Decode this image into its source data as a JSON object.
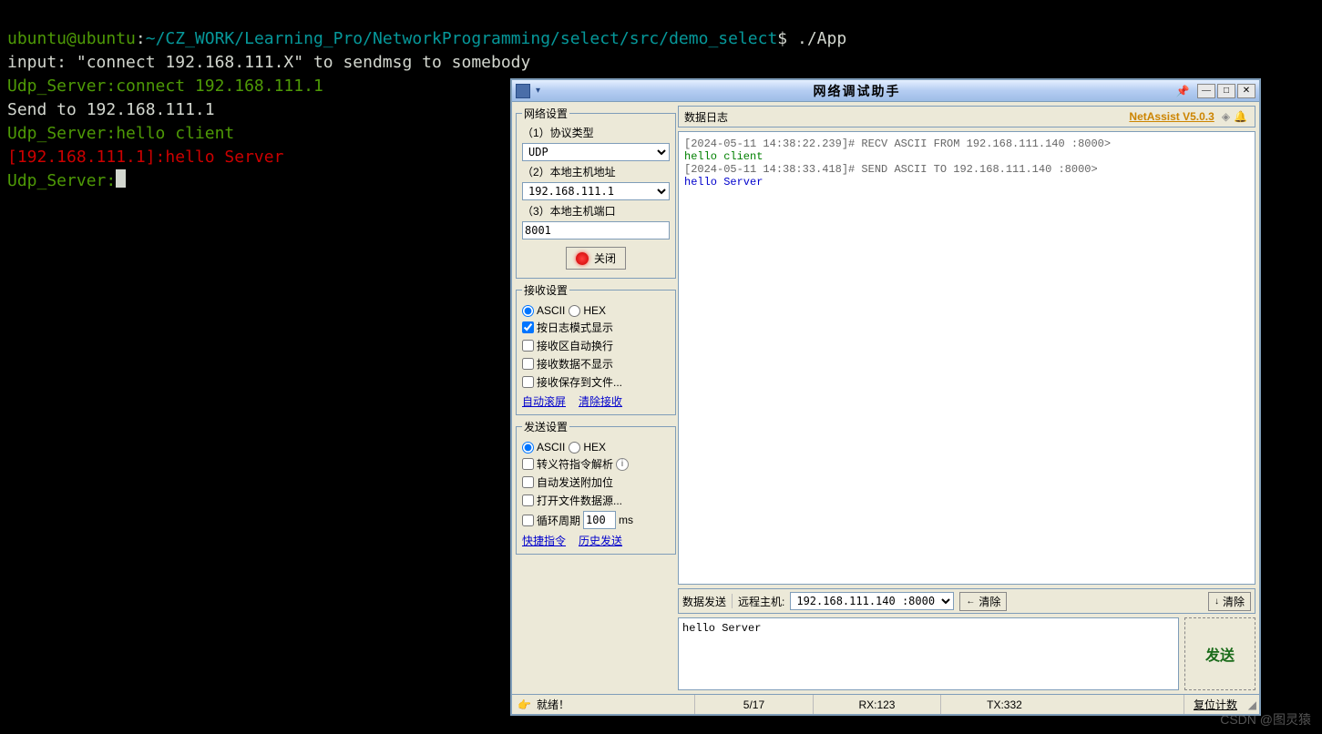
{
  "terminal": {
    "prompt_user": "ubuntu@ubuntu",
    "prompt_path": "~/CZ_WORK/Learning_Pro/NetworkProgramming/select/src/demo_select",
    "prompt_cmd": "./App",
    "line2": "input: \"connect 192.168.111.X\" to sendmsg to somebody",
    "line3": "Udp_Server:connect 192.168.111.1",
    "line4": "Send to 192.168.111.1",
    "line5": "Udp_Server:hello client",
    "line6_prefix": "[192.168.111.1]:",
    "line6_msg": "hello Server",
    "line7": "Udp_Server:"
  },
  "app": {
    "title": "网络调试助手",
    "brand": "NetAssist V5.0.3",
    "groups": {
      "net": "网络设置",
      "recv": "接收设置",
      "send": "发送设置"
    },
    "net": {
      "proto_label": "（1）协议类型",
      "proto_value": "UDP",
      "host_label": "（2）本地主机地址",
      "host_value": "192.168.111.1",
      "port_label": "（3）本地主机端口",
      "port_value": "8001",
      "close_btn": "关闭"
    },
    "recv": {
      "ascii": "ASCII",
      "hex": "HEX",
      "opt1": "按日志模式显示",
      "opt2": "接收区自动换行",
      "opt3": "接收数据不显示",
      "opt4": "接收保存到文件...",
      "link1": "自动滚屏",
      "link2": "清除接收"
    },
    "send": {
      "ascii": "ASCII",
      "hex": "HEX",
      "opt1": "转义符指令解析",
      "opt2": "自动发送附加位",
      "opt3": "打开文件数据源...",
      "opt4_pre": "循环周期",
      "opt4_val": "100",
      "opt4_suf": "ms",
      "link1": "快捷指令",
      "link2": "历史发送"
    },
    "log": {
      "header": "数据日志",
      "l1": "[2024-05-11 14:38:22.239]# RECV ASCII FROM 192.168.111.140 :8000>",
      "l2": "hello client",
      "l3": "[2024-05-11 14:38:33.418]# SEND ASCII TO 192.168.111.140 :8000>",
      "l4": "hello Server"
    },
    "sendbar": {
      "tab": "数据发送",
      "remote_lbl": "远程主机:",
      "remote_val": "192.168.111.140 :8000",
      "clear1": "清除",
      "clear2": "清除",
      "send_btn": "发送",
      "textbox": "hello Server"
    },
    "status": {
      "ready": "就绪！",
      "ratio": "5/17",
      "rx": "RX:123",
      "tx": "TX:332",
      "reset": "复位计数"
    }
  },
  "watermark": "CSDN @图灵猿"
}
